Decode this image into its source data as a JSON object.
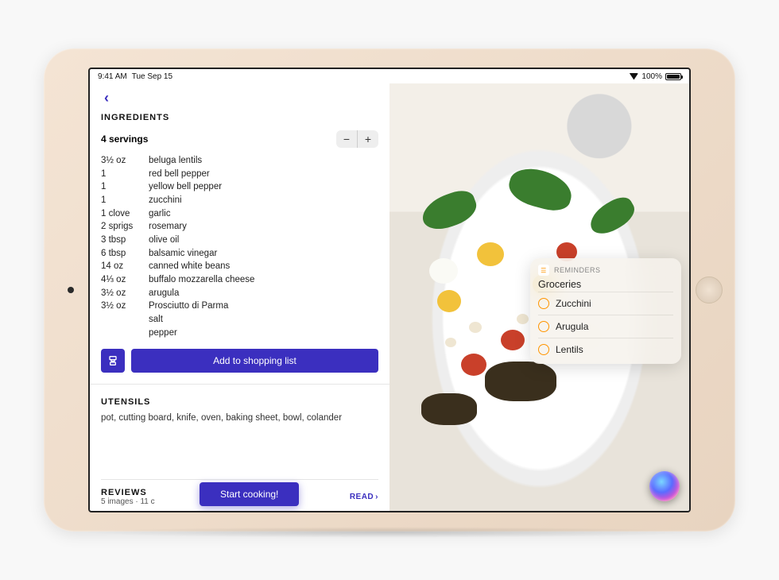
{
  "status": {
    "time": "9:41 AM",
    "date": "Tue Sep 15",
    "battery": "100%"
  },
  "sections": {
    "ingredients_title": "INGREDIENTS",
    "utensils_title": "UTENSILS",
    "reviews_title": "REVIEWS"
  },
  "servings": {
    "label": "4 servings"
  },
  "ingredients": [
    {
      "qty": "3½ oz",
      "name": "beluga lentils"
    },
    {
      "qty": "1",
      "name": "red bell pepper"
    },
    {
      "qty": "1",
      "name": "yellow bell pepper"
    },
    {
      "qty": "1",
      "name": "zucchini"
    },
    {
      "qty": "1 clove",
      "name": "garlic"
    },
    {
      "qty": "2 sprigs",
      "name": "rosemary"
    },
    {
      "qty": "3 tbsp",
      "name": "olive oil"
    },
    {
      "qty": "6 tbsp",
      "name": "balsamic vinegar"
    },
    {
      "qty": "14 oz",
      "name": "canned white beans"
    },
    {
      "qty": "4⅓ oz",
      "name": "buffalo mozzarella cheese"
    },
    {
      "qty": "3½ oz",
      "name": "arugula"
    },
    {
      "qty": "3½ oz",
      "name": "Prosciutto di Parma"
    },
    {
      "qty": "",
      "name": "salt"
    },
    {
      "qty": "",
      "name": "pepper"
    }
  ],
  "buttons": {
    "add_to_list": "Add to shopping list",
    "start_cooking": "Start cooking!",
    "read": "READ"
  },
  "utensils": "pot, cutting board, knife, oven, baking sheet, bowl, colander",
  "reviews_meta": "5 images · 11 c",
  "reminders": {
    "app_label": "REMINDERS",
    "list_title": "Groceries",
    "items": [
      "Zucchini",
      "Arugula",
      "Lentils"
    ]
  }
}
